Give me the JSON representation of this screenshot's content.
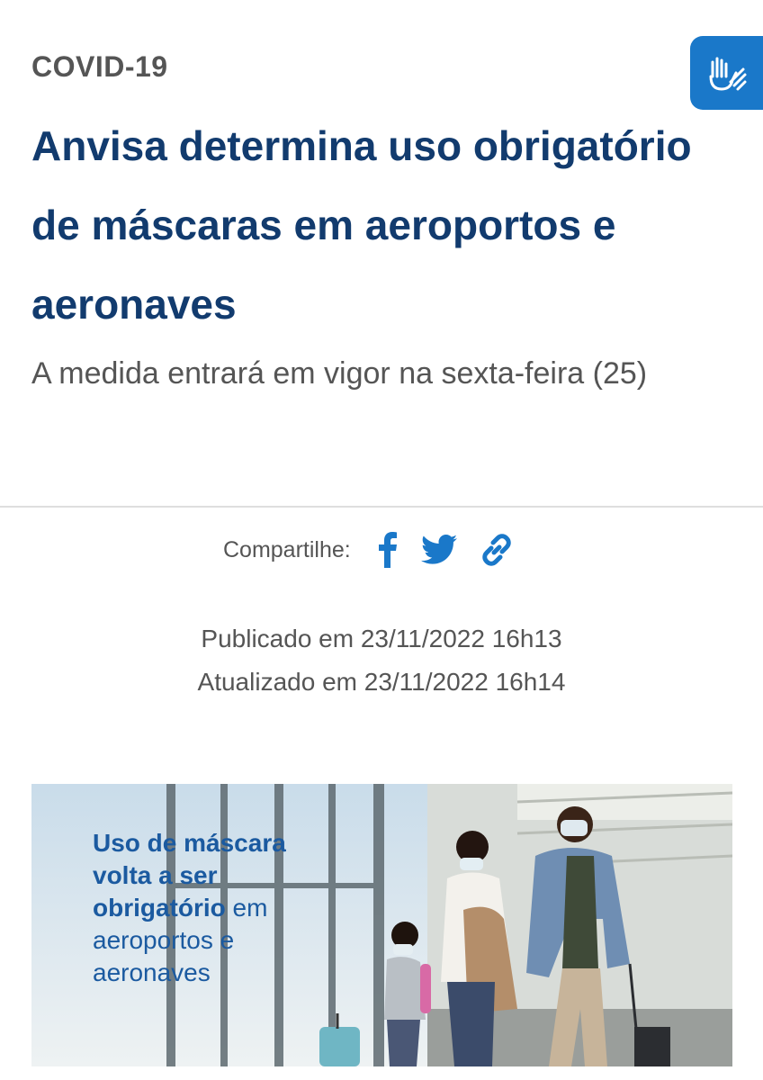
{
  "article": {
    "category": "COVID-19",
    "title": "Anvisa determina uso obrigatório de máscaras em aeroportos e aeronaves",
    "subtitle": "A medida entrará em vigor na sexta-feira (25)"
  },
  "share": {
    "label": "Compartilhe:",
    "icons": [
      "facebook-icon",
      "twitter-icon",
      "link-icon"
    ]
  },
  "dates": {
    "published": "Publicado em 23/11/2022 16h13",
    "updated": "Atualizado em 23/11/2022 16h14"
  },
  "hero_image": {
    "line1": "Uso de máscara",
    "line2": "volta a ser",
    "line3_bold": "obrigatório",
    "line3_rest": " em",
    "line4": "aeroportos e",
    "line5": "aeronaves"
  },
  "colors": {
    "title": "#123b6e",
    "accent": "#1a78c9",
    "text": "#555555"
  }
}
